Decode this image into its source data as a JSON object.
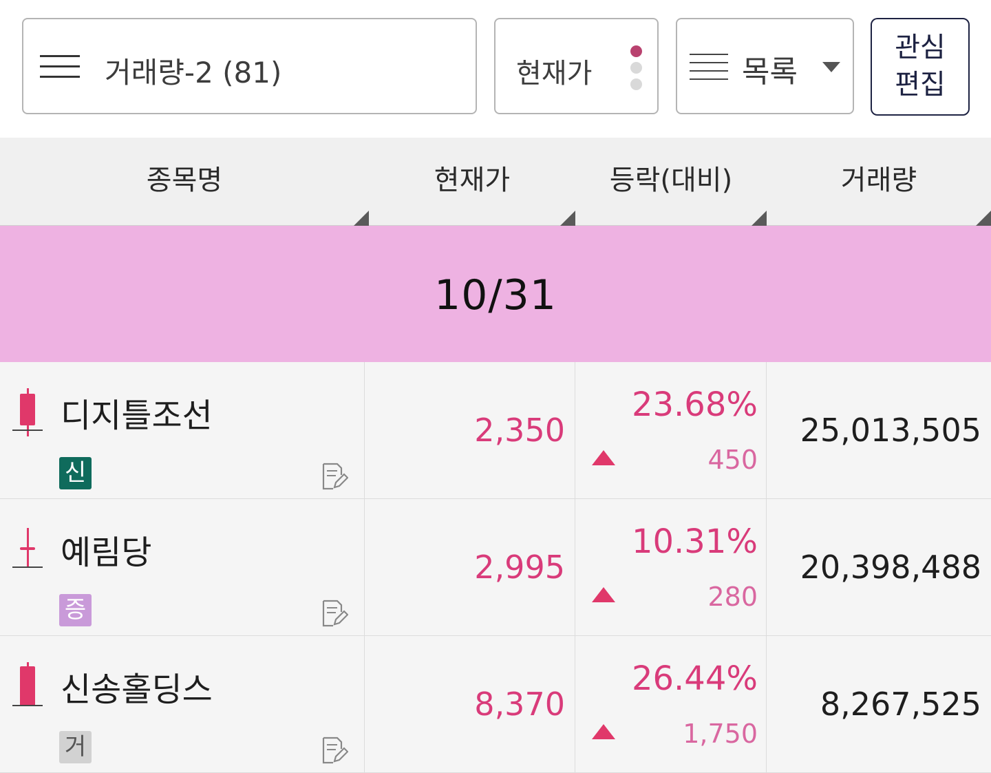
{
  "toolbar": {
    "group_name": "거래량-2 (81)",
    "price_mode": "현재가",
    "view_mode": "목록",
    "edit_label_line1": "관심",
    "edit_label_line2": "편집"
  },
  "columns": {
    "name": "종목명",
    "price": "현재가",
    "change": "등락(대비)",
    "volume": "거래량"
  },
  "banner": {
    "date": "10/31"
  },
  "colors": {
    "up": "#d93b7a",
    "banner": "#eeb2e2"
  },
  "rows": [
    {
      "name": "디지틀조선",
      "badge": "신",
      "badge_color": "#0f6b5c",
      "price": "2,350",
      "rate": "23.68%",
      "diff": "450",
      "volume": "25,013,505",
      "candle": "bullish-long",
      "icons": [
        "candle-icon",
        "memo-edit-icon",
        "up-triangle-icon"
      ]
    },
    {
      "name": "예림당",
      "badge": "증",
      "badge_color": "#c99ad9",
      "price": "2,995",
      "rate": "10.31%",
      "diff": "280",
      "volume": "20,398,488",
      "candle": "doji",
      "icons": [
        "candle-icon",
        "memo-edit-icon",
        "up-triangle-icon"
      ]
    },
    {
      "name": "신송홀딩스",
      "badge": "거",
      "badge_color": "#d2d2d2",
      "price": "8,370",
      "rate": "26.44%",
      "diff": "1,750",
      "volume": "8,267,525",
      "candle": "bullish-full",
      "icons": [
        "candle-icon",
        "memo-edit-icon",
        "up-triangle-icon"
      ]
    }
  ]
}
